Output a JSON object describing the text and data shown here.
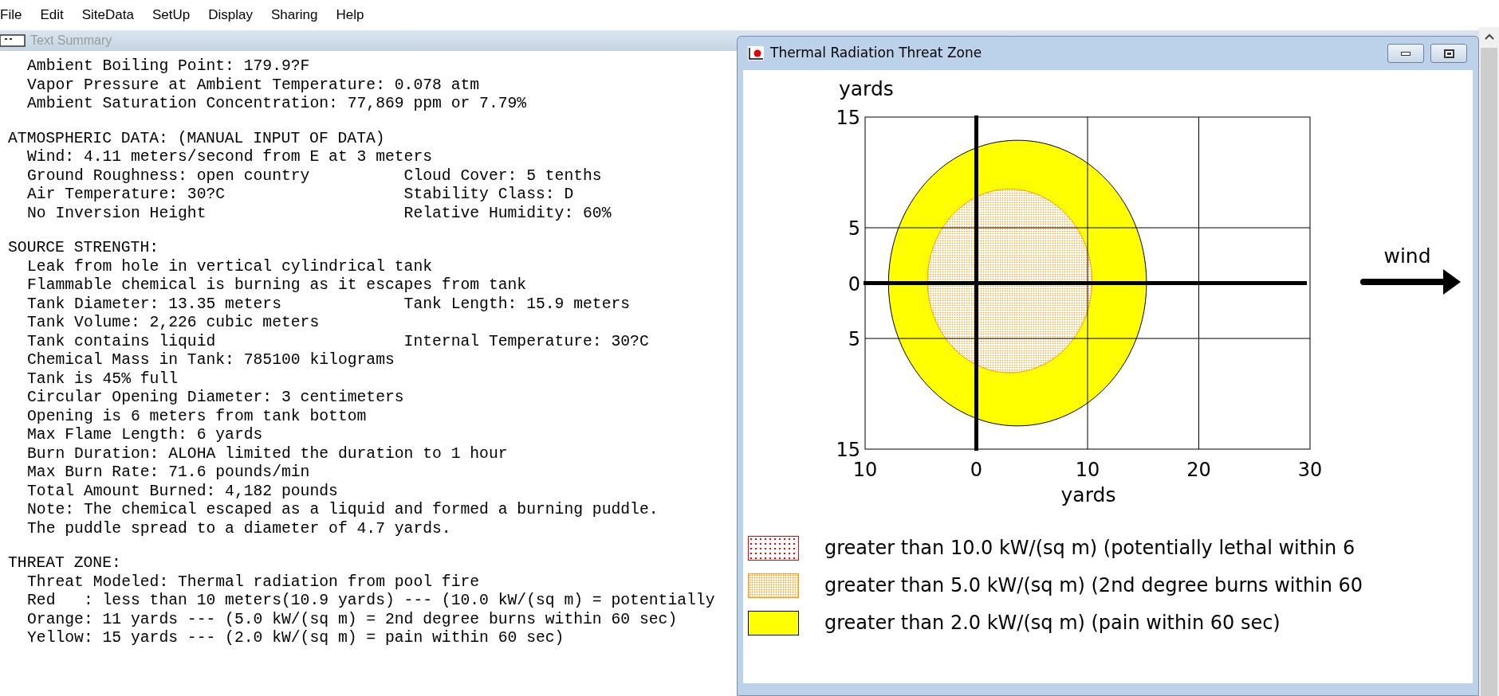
{
  "menu": [
    "File",
    "Edit",
    "SiteData",
    "SetUp",
    "Display",
    "Sharing",
    "Help"
  ],
  "text_summary": {
    "title": "Text Summary",
    "sections": [
      {
        "lines": [
          {
            "text": "Ambient Boiling Point: 179.9?F"
          },
          {
            "text": "Vapor Pressure at Ambient Temperature: 0.078 atm"
          },
          {
            "text": "Ambient Saturation Concentration: 77,869 ppm or 7.79%"
          }
        ]
      },
      {
        "heading": "ATMOSPHERIC DATA: (MANUAL INPUT OF DATA)",
        "lines": [
          {
            "text": "Wind: 4.11 meters/second from E at 3 meters"
          },
          {
            "text": "Ground Roughness: open country",
            "right": "Cloud Cover: 5 tenths"
          },
          {
            "text": "Air Temperature: 30?C",
            "right": "Stability Class: D"
          },
          {
            "text": "No Inversion Height",
            "right": "Relative Humidity: 60%"
          }
        ]
      },
      {
        "heading": "SOURCE STRENGTH:",
        "lines": [
          {
            "text": "Leak from hole in vertical cylindrical tank"
          },
          {
            "text": "Flammable chemical is burning as it escapes from tank"
          },
          {
            "text": "Tank Diameter: 13.35 meters",
            "right": "Tank Length: 15.9 meters"
          },
          {
            "text": "Tank Volume: 2,226 cubic meters"
          },
          {
            "text": "Tank contains liquid",
            "right": "Internal Temperature: 30?C"
          },
          {
            "text": "Chemical Mass in Tank: 785100 kilograms"
          },
          {
            "text": "Tank is 45% full"
          },
          {
            "text": "Circular Opening Diameter: 3 centimeters"
          },
          {
            "text": "Opening is 6 meters from tank bottom"
          },
          {
            "text": "Max Flame Length: 6 yards"
          },
          {
            "text": "Burn Duration: ALOHA limited the duration to 1 hour"
          },
          {
            "text": "Max Burn Rate: 71.6 pounds/min"
          },
          {
            "text": "Total Amount Burned: 4,182 pounds"
          },
          {
            "text": "Note: The chemical escaped as a liquid and formed a burning puddle."
          },
          {
            "text": "The puddle spread to a diameter of 4.7 yards."
          }
        ]
      },
      {
        "heading": "THREAT ZONE:",
        "lines": [
          {
            "text": "Threat Modeled: Thermal radiation from pool fire"
          },
          {
            "text": "Red   : less than 10 meters(10.9 yards) --- (10.0 kW/(sq m) = potentially"
          },
          {
            "text": "Orange: 11 yards --- (5.0 kW/(sq m) = 2nd degree burns within 60 sec)"
          },
          {
            "text": "Yellow: 15 yards --- (2.0 kW/(sq m) = pain within 60 sec)"
          }
        ]
      }
    ]
  },
  "threat_window": {
    "title": "Thermal Radiation Threat Zone",
    "plot": {
      "ylabel": "yards",
      "xlabel": "yards",
      "ytick_labels": [
        "15",
        "5",
        "0",
        "5",
        "15"
      ],
      "xtick_labels": [
        "10",
        "0",
        "10",
        "20",
        "30"
      ]
    },
    "wind_label": "wind",
    "legend": [
      {
        "kind": "sparse-dots",
        "color": "#ff0000",
        "label": "greater than 10.0 kW/(sq m) (potentially lethal within 6"
      },
      {
        "kind": "dense-dots",
        "color": "#ff9900",
        "label": "greater than 5.0 kW/(sq m) (2nd degree burns within 60"
      },
      {
        "kind": "solid",
        "color": "#ffff00",
        "label": "greater than 2.0 kW/(sq m) (pain within 60 sec)"
      }
    ]
  }
}
